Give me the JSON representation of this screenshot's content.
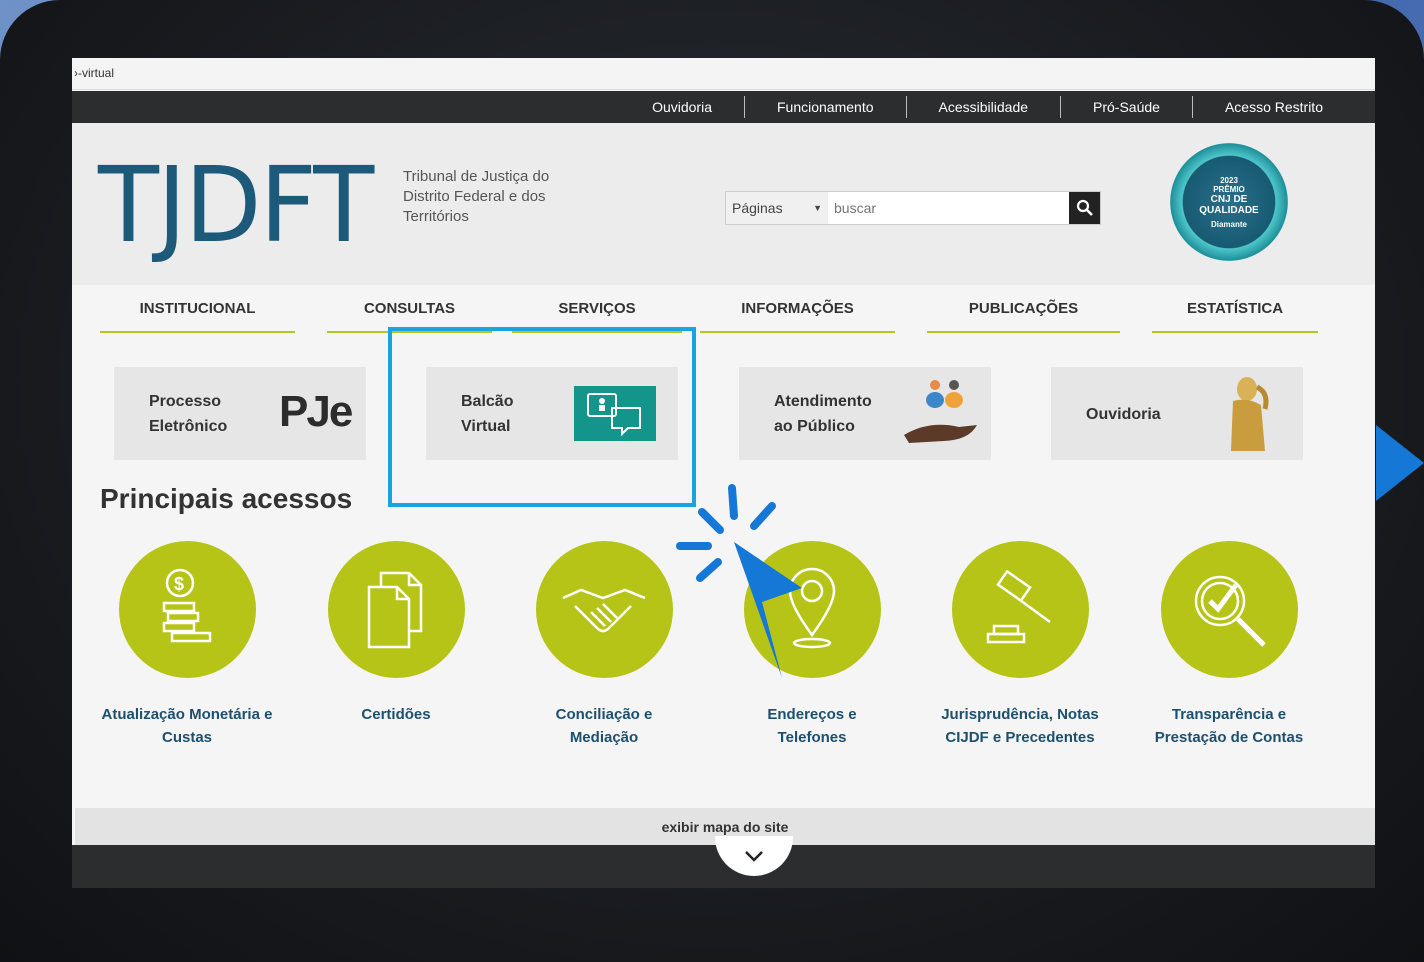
{
  "browser": {
    "address": "›-virtual"
  },
  "topbar": {
    "links": [
      "Ouvidoria",
      "Funcionamento",
      "Acessibilidade",
      "Pró-Saúde",
      "Acesso Restrito"
    ]
  },
  "header": {
    "logo": "TJDFT",
    "tagline": "Tribunal de Justiça do Distrito Federal e dos Territórios",
    "search": {
      "select_value": "Páginas",
      "placeholder": "buscar"
    },
    "seal": {
      "year": "2023",
      "line1": "PRÊMIO",
      "line2": "CNJ DE",
      "line3": "QUALIDADE",
      "level": "Diamante"
    }
  },
  "nav": {
    "items": [
      "INSTITUCIONAL",
      "CONSULTAS",
      "SERVIÇOS",
      "INFORMAÇÕES",
      "PUBLICAÇÕES",
      "ESTATÍSTICA"
    ]
  },
  "cards": [
    {
      "line1": "Processo",
      "line2": "Eletrônico",
      "icon": "pje-logo"
    },
    {
      "line1": "Balcão",
      "line2": "Virtual",
      "icon": "video-chat-icon"
    },
    {
      "line1": "Atendimento",
      "line2": "ao Público",
      "icon": "people-hand-icon"
    },
    {
      "line1": "Ouvidoria",
      "line2": "",
      "icon": "listening-statue-icon"
    }
  ],
  "pje_text": "PJe",
  "main": {
    "section_title": "Principais acessos",
    "accesses": [
      {
        "line1": "Atualização Monetária e",
        "line2": "Custas",
        "icon": "coins-icon"
      },
      {
        "line1": "Certidões",
        "line2": "",
        "icon": "documents-icon"
      },
      {
        "line1": "Conciliação e",
        "line2": "Mediação",
        "icon": "handshake-icon"
      },
      {
        "line1": "Endereços e",
        "line2": "Telefones",
        "icon": "location-pin-icon"
      },
      {
        "line1": "Jurisprudência, Notas",
        "line2": "CIJDF e Precedentes",
        "icon": "gavel-icon"
      },
      {
        "line1": "Transparência e",
        "line2": "Prestação de Contas",
        "icon": "magnifier-check-icon"
      }
    ]
  },
  "footer": {
    "sitemap_label": "exibir mapa do site"
  },
  "colors": {
    "accent_green": "#b6c418",
    "brand_blue": "#1d5a7a",
    "cursor_blue": "#1577d6",
    "highlight": "#1aa3e0"
  }
}
